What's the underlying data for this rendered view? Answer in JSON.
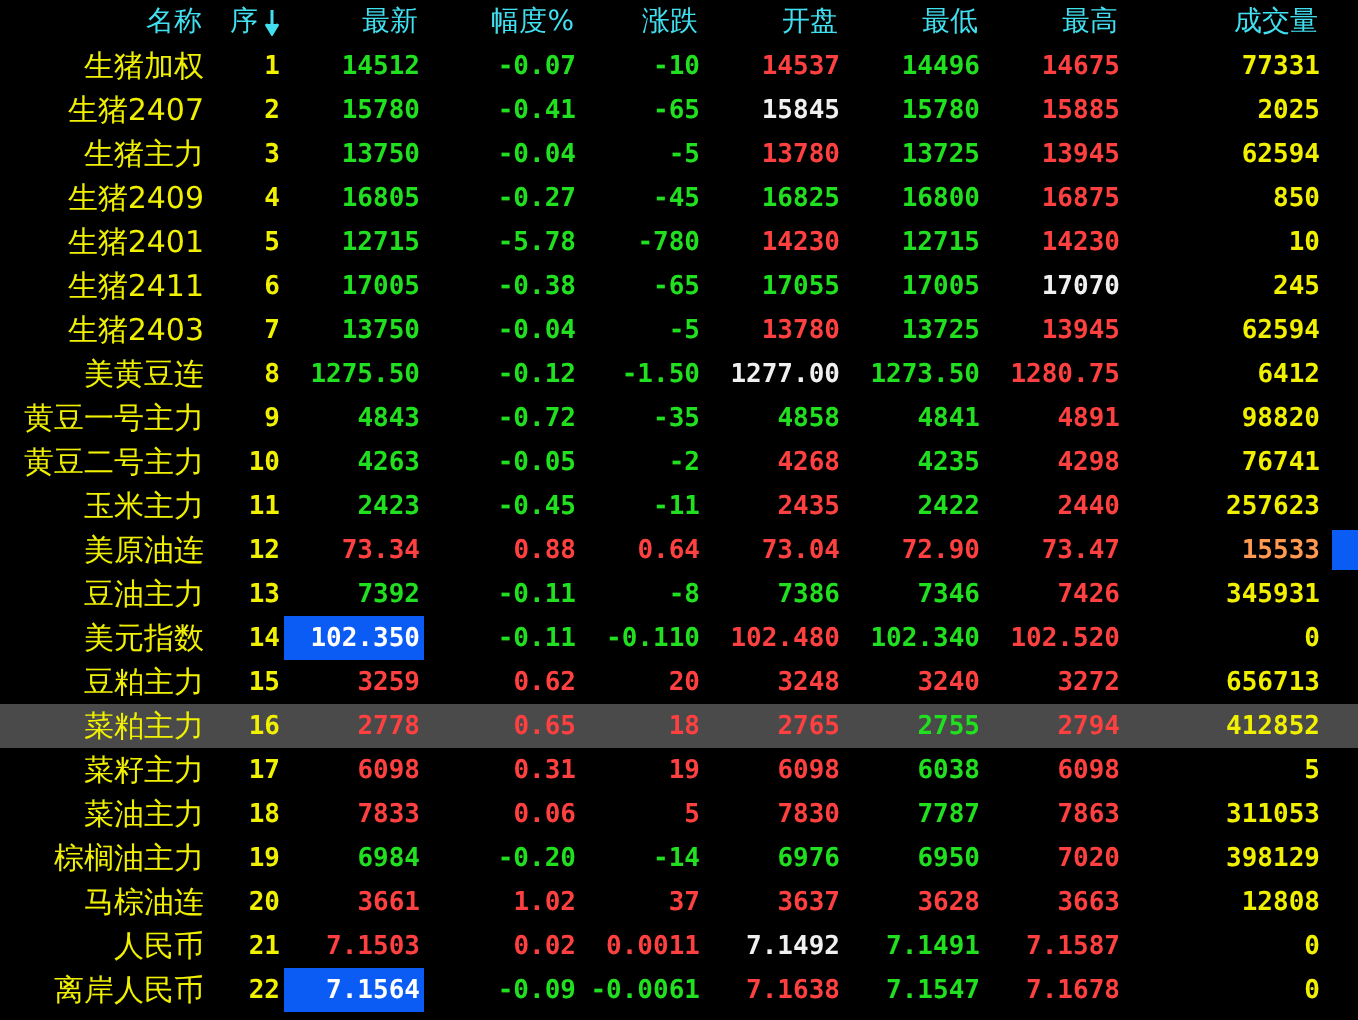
{
  "columns": [
    {
      "label": "名称",
      "sorted": false
    },
    {
      "label": "序",
      "sorted": true
    },
    {
      "label": "最新",
      "sorted": false
    },
    {
      "label": "幅度%",
      "sorted": false
    },
    {
      "label": "涨跌",
      "sorted": false
    },
    {
      "label": "开盘",
      "sorted": false
    },
    {
      "label": "最低",
      "sorted": false
    },
    {
      "label": "最高",
      "sorted": false
    },
    {
      "label": "成交量",
      "sorted": false
    }
  ],
  "rows": [
    {
      "name": "生猪加权",
      "seq": "1",
      "selected": false,
      "alert": false,
      "latest": {
        "text": "14512",
        "color": "#20e020",
        "boxed": false
      },
      "cells": [
        {
          "text": "-0.07",
          "color": "#20e020"
        },
        {
          "text": "-10",
          "color": "#20e020"
        },
        {
          "text": "14537",
          "color": "#ff4040"
        },
        {
          "text": "14496",
          "color": "#20e020"
        },
        {
          "text": "14675",
          "color": "#ff4040"
        }
      ],
      "volume": "77331"
    },
    {
      "name": "生猪2407",
      "seq": "2",
      "selected": false,
      "alert": false,
      "latest": {
        "text": "15780",
        "color": "#20e020",
        "boxed": false
      },
      "cells": [
        {
          "text": "-0.41",
          "color": "#20e020"
        },
        {
          "text": "-65",
          "color": "#20e020"
        },
        {
          "text": "15845",
          "color": "#f0f0f0"
        },
        {
          "text": "15780",
          "color": "#20e020"
        },
        {
          "text": "15885",
          "color": "#ff4040"
        }
      ],
      "volume": "2025"
    },
    {
      "name": "生猪主力",
      "seq": "3",
      "selected": false,
      "alert": false,
      "latest": {
        "text": "13750",
        "color": "#20e020",
        "boxed": false
      },
      "cells": [
        {
          "text": "-0.04",
          "color": "#20e020"
        },
        {
          "text": "-5",
          "color": "#20e020"
        },
        {
          "text": "13780",
          "color": "#ff4040"
        },
        {
          "text": "13725",
          "color": "#20e020"
        },
        {
          "text": "13945",
          "color": "#ff4040"
        }
      ],
      "volume": "62594"
    },
    {
      "name": "生猪2409",
      "seq": "4",
      "selected": false,
      "alert": false,
      "latest": {
        "text": "16805",
        "color": "#20e020",
        "boxed": false
      },
      "cells": [
        {
          "text": "-0.27",
          "color": "#20e020"
        },
        {
          "text": "-45",
          "color": "#20e020"
        },
        {
          "text": "16825",
          "color": "#20e020"
        },
        {
          "text": "16800",
          "color": "#20e020"
        },
        {
          "text": "16875",
          "color": "#ff4040"
        }
      ],
      "volume": "850"
    },
    {
      "name": "生猪2401",
      "seq": "5",
      "selected": false,
      "alert": false,
      "latest": {
        "text": "12715",
        "color": "#20e020",
        "boxed": false
      },
      "cells": [
        {
          "text": "-5.78",
          "color": "#20e020"
        },
        {
          "text": "-780",
          "color": "#20e020"
        },
        {
          "text": "14230",
          "color": "#ff4040"
        },
        {
          "text": "12715",
          "color": "#20e020"
        },
        {
          "text": "14230",
          "color": "#ff4040"
        }
      ],
      "volume": "10"
    },
    {
      "name": "生猪2411",
      "seq": "6",
      "selected": false,
      "alert": false,
      "latest": {
        "text": "17005",
        "color": "#20e020",
        "boxed": false
      },
      "cells": [
        {
          "text": "-0.38",
          "color": "#20e020"
        },
        {
          "text": "-65",
          "color": "#20e020"
        },
        {
          "text": "17055",
          "color": "#20e020"
        },
        {
          "text": "17005",
          "color": "#20e020"
        },
        {
          "text": "17070",
          "color": "#f0f0f0"
        }
      ],
      "volume": "245"
    },
    {
      "name": "生猪2403",
      "seq": "7",
      "selected": false,
      "alert": false,
      "latest": {
        "text": "13750",
        "color": "#20e020",
        "boxed": false
      },
      "cells": [
        {
          "text": "-0.04",
          "color": "#20e020"
        },
        {
          "text": "-5",
          "color": "#20e020"
        },
        {
          "text": "13780",
          "color": "#ff4040"
        },
        {
          "text": "13725",
          "color": "#20e020"
        },
        {
          "text": "13945",
          "color": "#ff4040"
        }
      ],
      "volume": "62594"
    },
    {
      "name": "美黄豆连",
      "seq": "8",
      "selected": false,
      "alert": false,
      "latest": {
        "text": "1275.50",
        "color": "#20e020",
        "boxed": false
      },
      "cells": [
        {
          "text": "-0.12",
          "color": "#20e020"
        },
        {
          "text": "-1.50",
          "color": "#20e020"
        },
        {
          "text": "1277.00",
          "color": "#f0f0f0"
        },
        {
          "text": "1273.50",
          "color": "#20e020"
        },
        {
          "text": "1280.75",
          "color": "#ff4040"
        }
      ],
      "volume": "6412"
    },
    {
      "name": "黄豆一号主力",
      "seq": "9",
      "selected": false,
      "alert": false,
      "latest": {
        "text": "4843",
        "color": "#20e020",
        "boxed": false
      },
      "cells": [
        {
          "text": "-0.72",
          "color": "#20e020"
        },
        {
          "text": "-35",
          "color": "#20e020"
        },
        {
          "text": "4858",
          "color": "#20e020"
        },
        {
          "text": "4841",
          "color": "#20e020"
        },
        {
          "text": "4891",
          "color": "#ff4040"
        }
      ],
      "volume": "98820"
    },
    {
      "name": "黄豆二号主力",
      "seq": "10",
      "selected": false,
      "alert": false,
      "latest": {
        "text": "4263",
        "color": "#20e020",
        "boxed": false
      },
      "cells": [
        {
          "text": "-0.05",
          "color": "#20e020"
        },
        {
          "text": "-2",
          "color": "#20e020"
        },
        {
          "text": "4268",
          "color": "#ff4040"
        },
        {
          "text": "4235",
          "color": "#20e020"
        },
        {
          "text": "4298",
          "color": "#ff4040"
        }
      ],
      "volume": "76741"
    },
    {
      "name": "玉米主力",
      "seq": "11",
      "selected": false,
      "alert": false,
      "latest": {
        "text": "2423",
        "color": "#20e020",
        "boxed": false
      },
      "cells": [
        {
          "text": "-0.45",
          "color": "#20e020"
        },
        {
          "text": "-11",
          "color": "#20e020"
        },
        {
          "text": "2435",
          "color": "#ff4040"
        },
        {
          "text": "2422",
          "color": "#20e020"
        },
        {
          "text": "2440",
          "color": "#ff4040"
        }
      ],
      "volume": "257623"
    },
    {
      "name": "美原油连",
      "seq": "12",
      "selected": false,
      "alert": true,
      "latest": {
        "text": "73.34",
        "color": "#ff4040",
        "boxed": false
      },
      "cells": [
        {
          "text": "0.88",
          "color": "#ff4040"
        },
        {
          "text": "0.64",
          "color": "#ff4040"
        },
        {
          "text": "73.04",
          "color": "#ff4040"
        },
        {
          "text": "72.90",
          "color": "#ff4040"
        },
        {
          "text": "73.47",
          "color": "#ff4040"
        }
      ],
      "volume": "15533"
    },
    {
      "name": "豆油主力",
      "seq": "13",
      "selected": false,
      "alert": false,
      "latest": {
        "text": "7392",
        "color": "#20e020",
        "boxed": false
      },
      "cells": [
        {
          "text": "-0.11",
          "color": "#20e020"
        },
        {
          "text": "-8",
          "color": "#20e020"
        },
        {
          "text": "7386",
          "color": "#20e020"
        },
        {
          "text": "7346",
          "color": "#20e020"
        },
        {
          "text": "7426",
          "color": "#ff4040"
        }
      ],
      "volume": "345931"
    },
    {
      "name": "美元指数",
      "seq": "14",
      "selected": false,
      "alert": false,
      "latest": {
        "text": "102.350",
        "color": "#ffffff",
        "boxed": true
      },
      "cells": [
        {
          "text": "-0.11",
          "color": "#20e020"
        },
        {
          "text": "-0.110",
          "color": "#20e020"
        },
        {
          "text": "102.480",
          "color": "#ff4040"
        },
        {
          "text": "102.340",
          "color": "#20e020"
        },
        {
          "text": "102.520",
          "color": "#ff4040"
        }
      ],
      "volume": "0"
    },
    {
      "name": "豆粕主力",
      "seq": "15",
      "selected": false,
      "alert": false,
      "latest": {
        "text": "3259",
        "color": "#ff4040",
        "boxed": false
      },
      "cells": [
        {
          "text": "0.62",
          "color": "#ff4040"
        },
        {
          "text": "20",
          "color": "#ff4040"
        },
        {
          "text": "3248",
          "color": "#ff4040"
        },
        {
          "text": "3240",
          "color": "#ff4040"
        },
        {
          "text": "3272",
          "color": "#ff4040"
        }
      ],
      "volume": "656713"
    },
    {
      "name": "菜粕主力",
      "seq": "16",
      "selected": true,
      "alert": false,
      "latest": {
        "text": "2778",
        "color": "#ff4040",
        "boxed": false
      },
      "cells": [
        {
          "text": "0.65",
          "color": "#ff4040"
        },
        {
          "text": "18",
          "color": "#ff4040"
        },
        {
          "text": "2765",
          "color": "#ff4040"
        },
        {
          "text": "2755",
          "color": "#20e020"
        },
        {
          "text": "2794",
          "color": "#ff4040"
        }
      ],
      "volume": "412852"
    },
    {
      "name": "菜籽主力",
      "seq": "17",
      "selected": false,
      "alert": false,
      "latest": {
        "text": "6098",
        "color": "#ff4040",
        "boxed": false
      },
      "cells": [
        {
          "text": "0.31",
          "color": "#ff4040"
        },
        {
          "text": "19",
          "color": "#ff4040"
        },
        {
          "text": "6098",
          "color": "#ff4040"
        },
        {
          "text": "6038",
          "color": "#20e020"
        },
        {
          "text": "6098",
          "color": "#ff4040"
        }
      ],
      "volume": "5"
    },
    {
      "name": "菜油主力",
      "seq": "18",
      "selected": false,
      "alert": false,
      "latest": {
        "text": "7833",
        "color": "#ff4040",
        "boxed": false
      },
      "cells": [
        {
          "text": "0.06",
          "color": "#ff4040"
        },
        {
          "text": "5",
          "color": "#ff4040"
        },
        {
          "text": "7830",
          "color": "#ff4040"
        },
        {
          "text": "7787",
          "color": "#20e020"
        },
        {
          "text": "7863",
          "color": "#ff4040"
        }
      ],
      "volume": "311053"
    },
    {
      "name": "棕榈油主力",
      "seq": "19",
      "selected": false,
      "alert": false,
      "latest": {
        "text": "6984",
        "color": "#20e020",
        "boxed": false
      },
      "cells": [
        {
          "text": "-0.20",
          "color": "#20e020"
        },
        {
          "text": "-14",
          "color": "#20e020"
        },
        {
          "text": "6976",
          "color": "#20e020"
        },
        {
          "text": "6950",
          "color": "#20e020"
        },
        {
          "text": "7020",
          "color": "#ff4040"
        }
      ],
      "volume": "398129"
    },
    {
      "name": "马棕油连",
      "seq": "20",
      "selected": false,
      "alert": false,
      "latest": {
        "text": "3661",
        "color": "#ff4040",
        "boxed": false
      },
      "cells": [
        {
          "text": "1.02",
          "color": "#ff4040"
        },
        {
          "text": "37",
          "color": "#ff4040"
        },
        {
          "text": "3637",
          "color": "#ff4040"
        },
        {
          "text": "3628",
          "color": "#ff4040"
        },
        {
          "text": "3663",
          "color": "#ff4040"
        }
      ],
      "volume": "12808"
    },
    {
      "name": "人民币",
      "seq": "21",
      "selected": false,
      "alert": false,
      "latest": {
        "text": "7.1503",
        "color": "#ff4040",
        "boxed": false
      },
      "cells": [
        {
          "text": "0.02",
          "color": "#ff4040"
        },
        {
          "text": "0.0011",
          "color": "#ff4040"
        },
        {
          "text": "7.1492",
          "color": "#f0f0f0"
        },
        {
          "text": "7.1491",
          "color": "#20e020"
        },
        {
          "text": "7.1587",
          "color": "#ff4040"
        }
      ],
      "volume": "0"
    },
    {
      "name": "离岸人民币",
      "seq": "22",
      "selected": false,
      "alert": false,
      "latest": {
        "text": "7.1564",
        "color": "#ffffff",
        "boxed": true
      },
      "cells": [
        {
          "text": "-0.09",
          "color": "#20e020"
        },
        {
          "text": "-0.0061",
          "color": "#20e020"
        },
        {
          "text": "7.1638",
          "color": "#ff4040"
        },
        {
          "text": "7.1547",
          "color": "#20e020"
        },
        {
          "text": "7.1678",
          "color": "#ff4040"
        }
      ],
      "volume": "0"
    }
  ]
}
